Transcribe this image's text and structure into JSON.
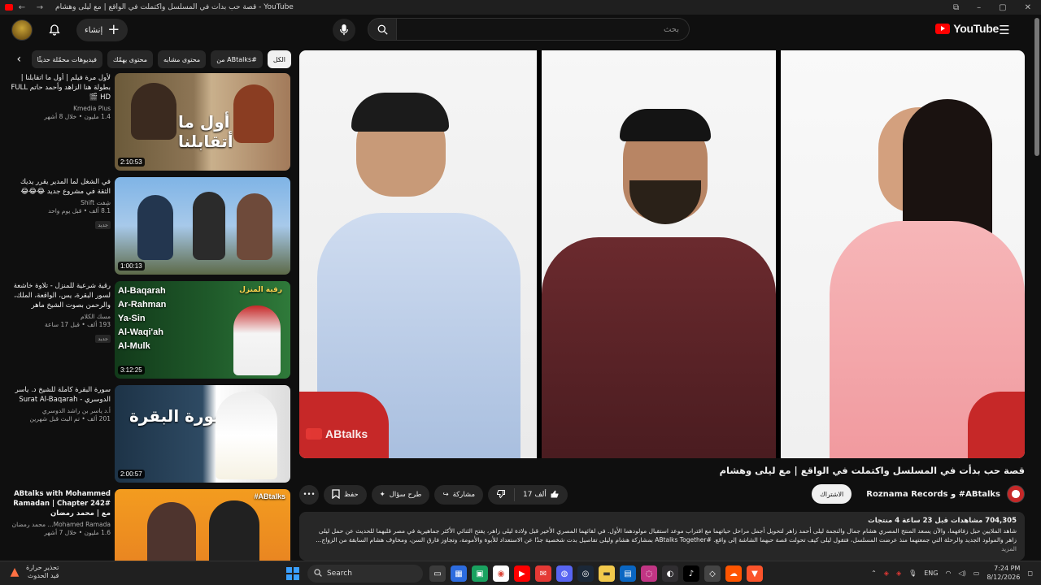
{
  "browser": {
    "title": "قصة حب بدأت في المسلسل واكتملت في الواقع | مع ليلى وهشام - YouTube",
    "icons": [
      "back-arrow-icon",
      "forward-arrow-icon",
      "extensions-icon",
      "minimize-icon",
      "restore-icon",
      "close-icon"
    ]
  },
  "header": {
    "logo_text": "YouTube",
    "create_label": "إنشاء",
    "search_placeholder": "بحث",
    "search_value": "",
    "icons": [
      "avatar",
      "bell-icon",
      "mic-icon",
      "search-icon",
      "menu-icon"
    ]
  },
  "chips": [
    "الكل",
    "من ABtalks#",
    "محتوى مشابه",
    "محتوى يهمّك",
    "فيديوهات محمّلة حديثًا"
  ],
  "recommendations": [
    {
      "title": "لأول مرة فيلم | أول ما اتقابلنا | بطولة هنا الزاهد وأحمد حاتم FULL HD 🎬",
      "channel": "Kmedia Plus",
      "views": "1.4 مليون",
      "age": "خلال 8 أشهر",
      "duration": "2:10:53",
      "thumb_text": "أول ما أتقابلنا",
      "badge": ""
    },
    {
      "title": "في الشغل لما المدير يقرر يديك الثقة في مشروع جديد 😂😂😂",
      "channel": "شِفت Shift",
      "views": "8.1 ألف",
      "age": "قبل يوم واحد",
      "duration": "1:00:13",
      "thumb_text": "",
      "badge": "جديد"
    },
    {
      "title": "رقية شرعية للمنزل - تلاوة خاشعة لسور البقرة، يس، الواقعة، الملك، والرحمن بصوت الشيخ ماهر المعيقلي 📿",
      "channel": "مسك الكلام",
      "views": "193 ألف",
      "age": "قبل 17 ساعة",
      "duration": "3:12:25",
      "thumb_text": "رقية المنزل",
      "badge": "جديد",
      "thumb_lines": [
        "Al-Baqarah",
        "Ar-Rahman",
        "Ya-Sin",
        "Al-Waqi'ah",
        "Al-Mulk"
      ]
    },
    {
      "title": "سورة البقرة كاملة للشيخ د. ياسر الدوسري - Surat Al-Baqarah",
      "channel": "أ.د ياسر بن راشد الدوسري",
      "views": "201 ألف",
      "age": "تم البث قبل شهرين",
      "duration": "2:00:57",
      "thumb_text": "سورة البقرة",
      "badge": ""
    },
    {
      "title": "ABtalks with Mohammed Ramadan | Chapter 242# مع | محمد رمضان",
      "channel": "Mohamed Ramada... محمد رمضان",
      "views": "1.6 مليون",
      "age": "خلال 7 أشهر",
      "duration": "",
      "thumb_text": "#ABtalks",
      "badge": ""
    }
  ],
  "video": {
    "title": "قصة حب بدأت في المسلسل واكتملت في الواقع | مع ليلى وهشام",
    "watermark": "ABtalks",
    "channel": "ABtalks# و Roznama Records",
    "subscribe_label": "الاشتراك",
    "likes": "17 ألف",
    "share_label": "مشاركة",
    "ask_label": "طرح سؤال",
    "save_label": "حفظ",
    "stats": "704,305 مشاهدات  قبل 23 ساعة  4 منتجات",
    "description": "شاهد الملايين حبل زفافهما، والآن يسعد المنتج المصري هشام جمال والنجمة ليلى أحمد زاهر لتحويل أجمل مراحل حياتهما مع اقتراب موعد استقبال مولودهما الأول. في لقائهما المصري الأخير قبل ولادة ليلى زاهر، يفتح الثنائي الأكثر جماهيرية في مصر قلبهما للحديث عن حمل ليلى زاهر والمولود الجديد والرحلة التي جمعتهما منذ عرضت المسلسل، فتقول ليلى كيف تحولت قصة حبهما الشاشة إلى واقع. #ABtalks Together بمشاركة هشام وليلى تفاصيل بدت شخصية جدًا عن الاستعداد للأبوة والأمومة، وتجاوز فارق السن، ومخاوف هشام السابقة من الزواج...",
    "more_label": "المزيد"
  },
  "taskbar": {
    "weather_line1": "تحذير حرارة",
    "weather_line2": "قيد الحدوث",
    "search_label": "Search",
    "lang": "ENG",
    "time": "7:24 PM",
    "date": "8/12/2026",
    "apps": [
      "file-explorer-icon",
      "store-icon",
      "app-icon",
      "chrome-icon",
      "youtube-icon",
      "mail-icon",
      "discord-icon",
      "steam-icon",
      "folder-icon",
      "app-icon",
      "instagram-icon",
      "obs-icon",
      "tiktok-icon",
      "app-icon",
      "soundcloud-icon",
      "brave-icon"
    ]
  }
}
